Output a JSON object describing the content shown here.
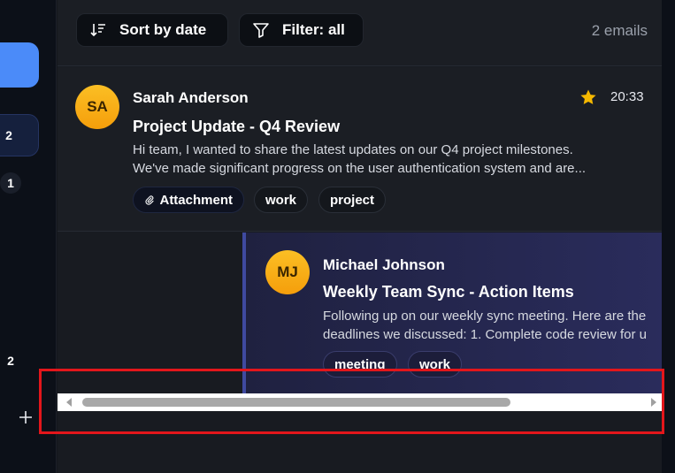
{
  "sidebar": {
    "counts": [
      "2",
      "1",
      "2"
    ],
    "add_icon": "plus-icon"
  },
  "toolbar": {
    "sort_label": "Sort by date",
    "filter_label": "Filter: all",
    "email_count": "2 emails"
  },
  "emails": [
    {
      "initials": "SA",
      "sender": "Sarah Anderson",
      "subject": "Project Update - Q4 Review",
      "preview": "Hi team, I wanted to share the latest updates on our Q4 project milestones. We've made significant progress on the user authentication system and are...",
      "time": "20:33",
      "starred": true,
      "tags": [
        "Attachment",
        "work",
        "project"
      ]
    },
    {
      "initials": "MJ",
      "sender": "Michael Johnson",
      "subject": "Weekly Team Sync - Action Items",
      "preview_line1": "Following up on our weekly sync meeting. Here are the",
      "preview_line2": "deadlines we discussed: 1. Complete code review for u",
      "tags": [
        "meeting",
        "work"
      ]
    }
  ],
  "colors": {
    "accent": "#4b8bf9",
    "avatar": "#fbbf24",
    "star": "#f5b800",
    "highlight": "#e3161b"
  }
}
